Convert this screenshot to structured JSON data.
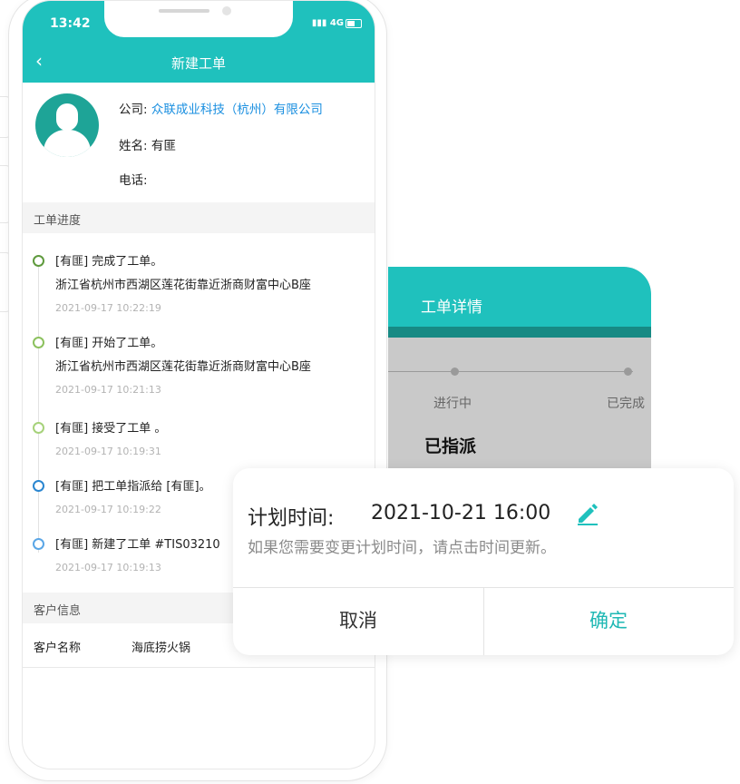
{
  "status_bar": {
    "time": "13:42",
    "network": "4G",
    "signal_icon": "signal-icon",
    "battery_icon": "battery-icon"
  },
  "nav": {
    "title": "新建工单",
    "back_icon": "chevron-left-icon"
  },
  "profile": {
    "company_label": "公司:",
    "company_value": "众联成业科技（杭州）有限公司",
    "name_label": "姓名:",
    "name_value": "有匪",
    "phone_label": "电话:",
    "phone_value": ""
  },
  "progress": {
    "header": "工单进度",
    "items": [
      {
        "title": "[有匪] 完成了工单。",
        "address": "浙江省杭州市西湖区莲花街靠近浙商财富中心B座",
        "date": "2021-09-17 10:22:19",
        "color": "#5f9a3e"
      },
      {
        "title": "[有匪] 开始了工单。",
        "address": "浙江省杭州市西湖区莲花街靠近浙商财富中心B座",
        "date": "2021-09-17 10:21:13",
        "color": "#8cc15e"
      },
      {
        "title": "[有匪] 接受了工单 。",
        "address": "",
        "date": "2021-09-17 10:19:31",
        "color": "#a6d27a"
      },
      {
        "title": "[有匪] 把工单指派给 [有匪]。",
        "address": "",
        "date": "2021-09-17 10:19:22",
        "color": "#2a86d0"
      },
      {
        "title": "[有匪] 新建了工单 #TIS03210",
        "address": "",
        "date": "2021-09-17 10:19:13",
        "color": "#5aa6e6"
      }
    ]
  },
  "customer": {
    "header": "客户信息",
    "name_label": "客户名称",
    "name_value": "海底捞火锅"
  },
  "detail_card": {
    "title": "工单详情",
    "steps": [
      "进行中",
      "已完成"
    ],
    "status": "已指派"
  },
  "dialog": {
    "plan_label": "计划时间:",
    "plan_value": "2021-10-21 16:00",
    "edit_icon": "pencil-icon",
    "hint": "如果您需要变更计划时间，请点击时间更新。",
    "cancel_label": "取消",
    "confirm_label": "确定",
    "accent_color": "#1fc1bd"
  }
}
